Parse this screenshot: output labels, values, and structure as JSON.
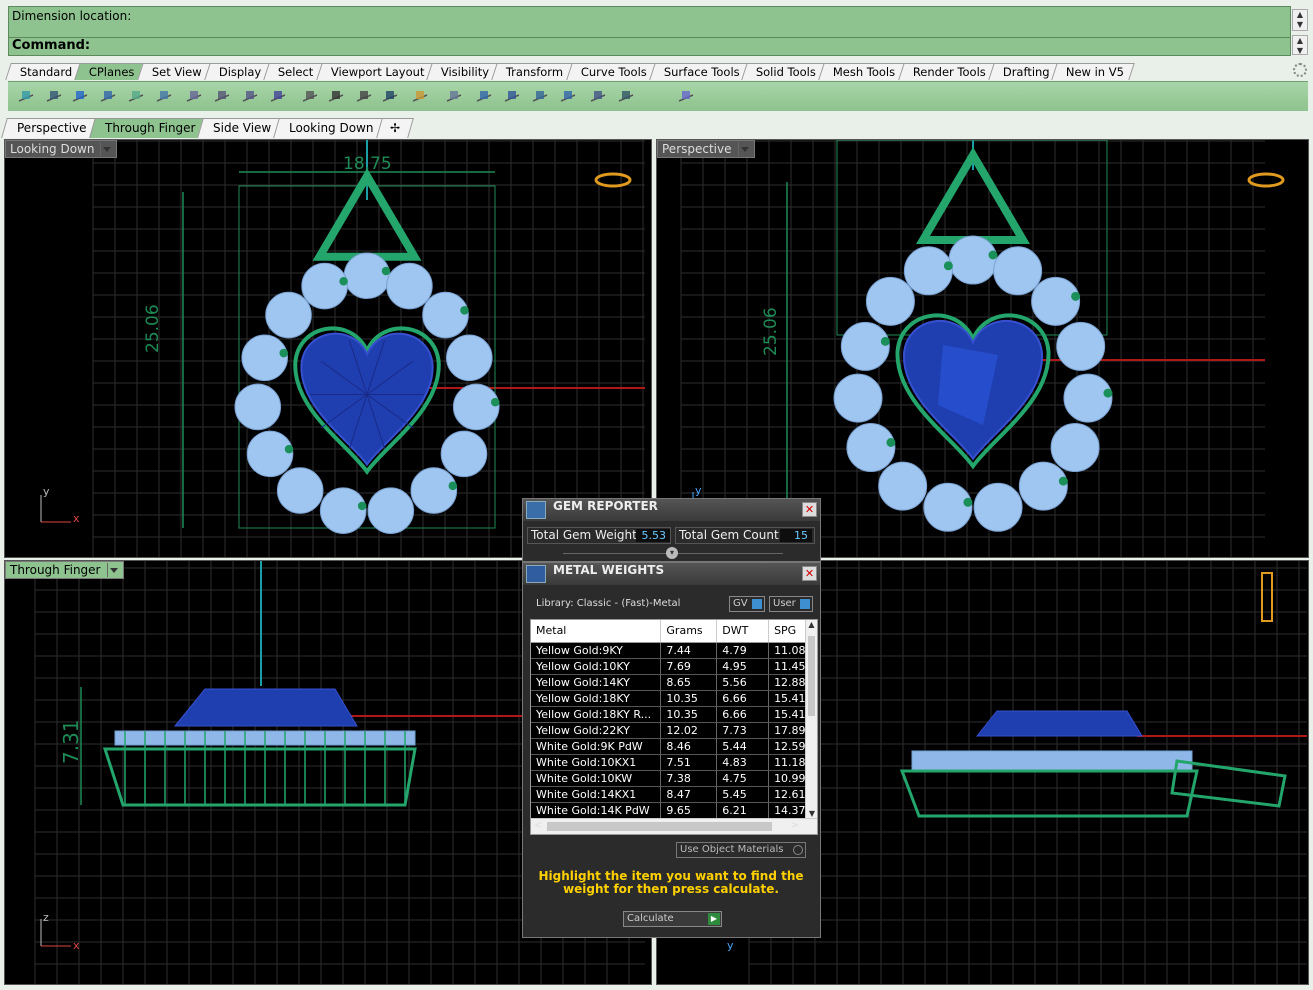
{
  "command": {
    "line1": "Dimension location:",
    "line2": "Command:"
  },
  "toolbar_tabs": [
    "Standard",
    "CPlanes",
    "Set View",
    "Display",
    "Select",
    "Viewport Layout",
    "Visibility",
    "Transform",
    "Curve Tools",
    "Surface Tools",
    "Solid Tools",
    "Mesh Tools",
    "Render Tools",
    "Drafting",
    "New in V5"
  ],
  "active_toolbar_tab": "CPlanes",
  "view_tabs": [
    "Perspective",
    "Through Finger",
    "Side View",
    "Looking Down"
  ],
  "active_view_tab": "Through Finger",
  "viewports": {
    "top_left": {
      "label": "Looking Down",
      "dim_width": "18.75",
      "dim_height": "25.06",
      "axis_a": "y",
      "axis_b": "x"
    },
    "top_right": {
      "label": "Perspective",
      "dim_height": "25.06",
      "axis_a": "y"
    },
    "bottom_left": {
      "label": "Through Finger",
      "dim_height": "7.31",
      "axis_a": "z",
      "axis_b": "x"
    },
    "bottom_right": {
      "axis_a": "y"
    }
  },
  "gem_reporter": {
    "title": "GEM REPORTER",
    "weight_label": "Total Gem Weight",
    "weight_value": "5.53",
    "count_label": "Total Gem Count",
    "count_value": "15"
  },
  "metal_weights": {
    "title": "METAL WEIGHTS",
    "library": "Library: Classic - (Fast)-Metal",
    "gv_label": "GV",
    "user_label": "User",
    "columns": [
      "Metal",
      "Grams",
      "DWT",
      "SPG"
    ],
    "rows": [
      [
        "Yellow Gold:9KY",
        "7.44",
        "4.79",
        "11.08"
      ],
      [
        "Yellow Gold:10KY",
        "7.69",
        "4.95",
        "11.45"
      ],
      [
        "Yellow Gold:14KY",
        "8.65",
        "5.56",
        "12.88"
      ],
      [
        "Yellow Gold:18KY",
        "10.35",
        "6.66",
        "15.41"
      ],
      [
        "Yellow Gold:18KY R...",
        "10.35",
        "6.66",
        "15.41"
      ],
      [
        "Yellow Gold:22KY",
        "12.02",
        "7.73",
        "17.89"
      ],
      [
        "White Gold:9K PdW",
        "8.46",
        "5.44",
        "12.59"
      ],
      [
        "White Gold:10KX1",
        "7.51",
        "4.83",
        "11.18"
      ],
      [
        "White Gold:10KW",
        "7.38",
        "4.75",
        "10.99"
      ],
      [
        "White Gold:14KX1",
        "8.47",
        "5.45",
        "12.61"
      ],
      [
        "White Gold:14K PdW",
        "9.65",
        "6.21",
        "14.37"
      ]
    ],
    "use_object_materials": "Use Object Materials",
    "note": "Highlight the item you want to find the weight for then press calculate.",
    "calculate_label": "Calculate"
  },
  "colors": {
    "panel_green": "#8ec28e",
    "gem_blue": "#1f3fb0",
    "stone_light": "#9fc6f0",
    "metal_green": "#1a8f5a"
  }
}
